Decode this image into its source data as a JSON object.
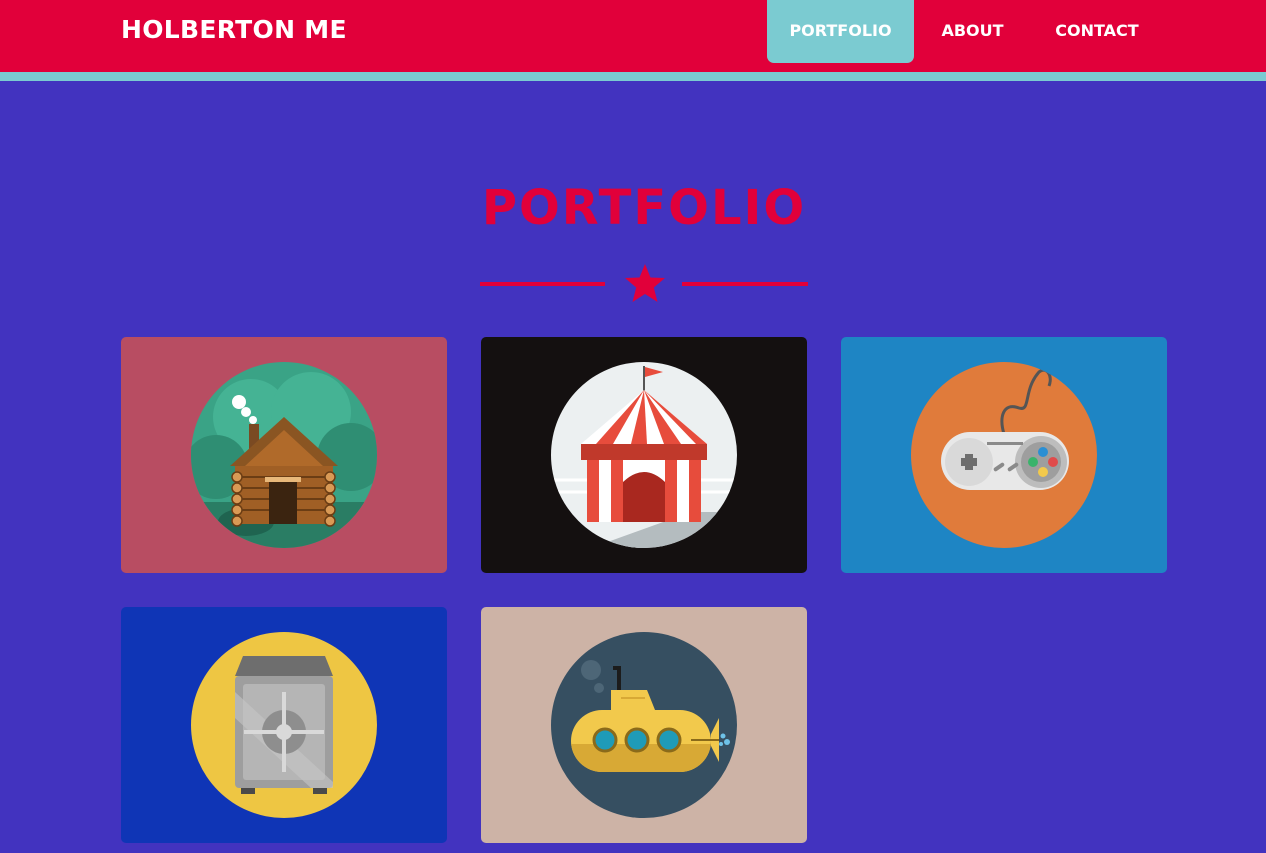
{
  "header": {
    "brand": "HOLBERTON ME",
    "nav": [
      {
        "label": "PORTFOLIO",
        "active": true
      },
      {
        "label": "ABOUT",
        "active": false
      },
      {
        "label": "CONTACT",
        "active": false
      }
    ]
  },
  "colors": {
    "header_bg": "#e1003a",
    "header_stripe": "#7bcbd1",
    "page_bg": "#4233bf",
    "title": "#e1003a"
  },
  "portfolio": {
    "title": "PORTFOLIO",
    "divider_icon": "star-icon",
    "items": [
      {
        "icon": "log-cabin-icon",
        "bg": "#b84d62",
        "circle": "#3aa386"
      },
      {
        "icon": "circus-tent-icon",
        "bg": "#141010",
        "circle": "#ecf0f1"
      },
      {
        "icon": "game-controller-icon",
        "bg": "#1e85c4",
        "circle": "#e07b3b"
      },
      {
        "icon": "safe-icon",
        "bg": "#0f35b6",
        "circle": "#eec643"
      },
      {
        "icon": "submarine-icon",
        "bg": "#cdb3a6",
        "circle": "#364f61"
      }
    ]
  }
}
